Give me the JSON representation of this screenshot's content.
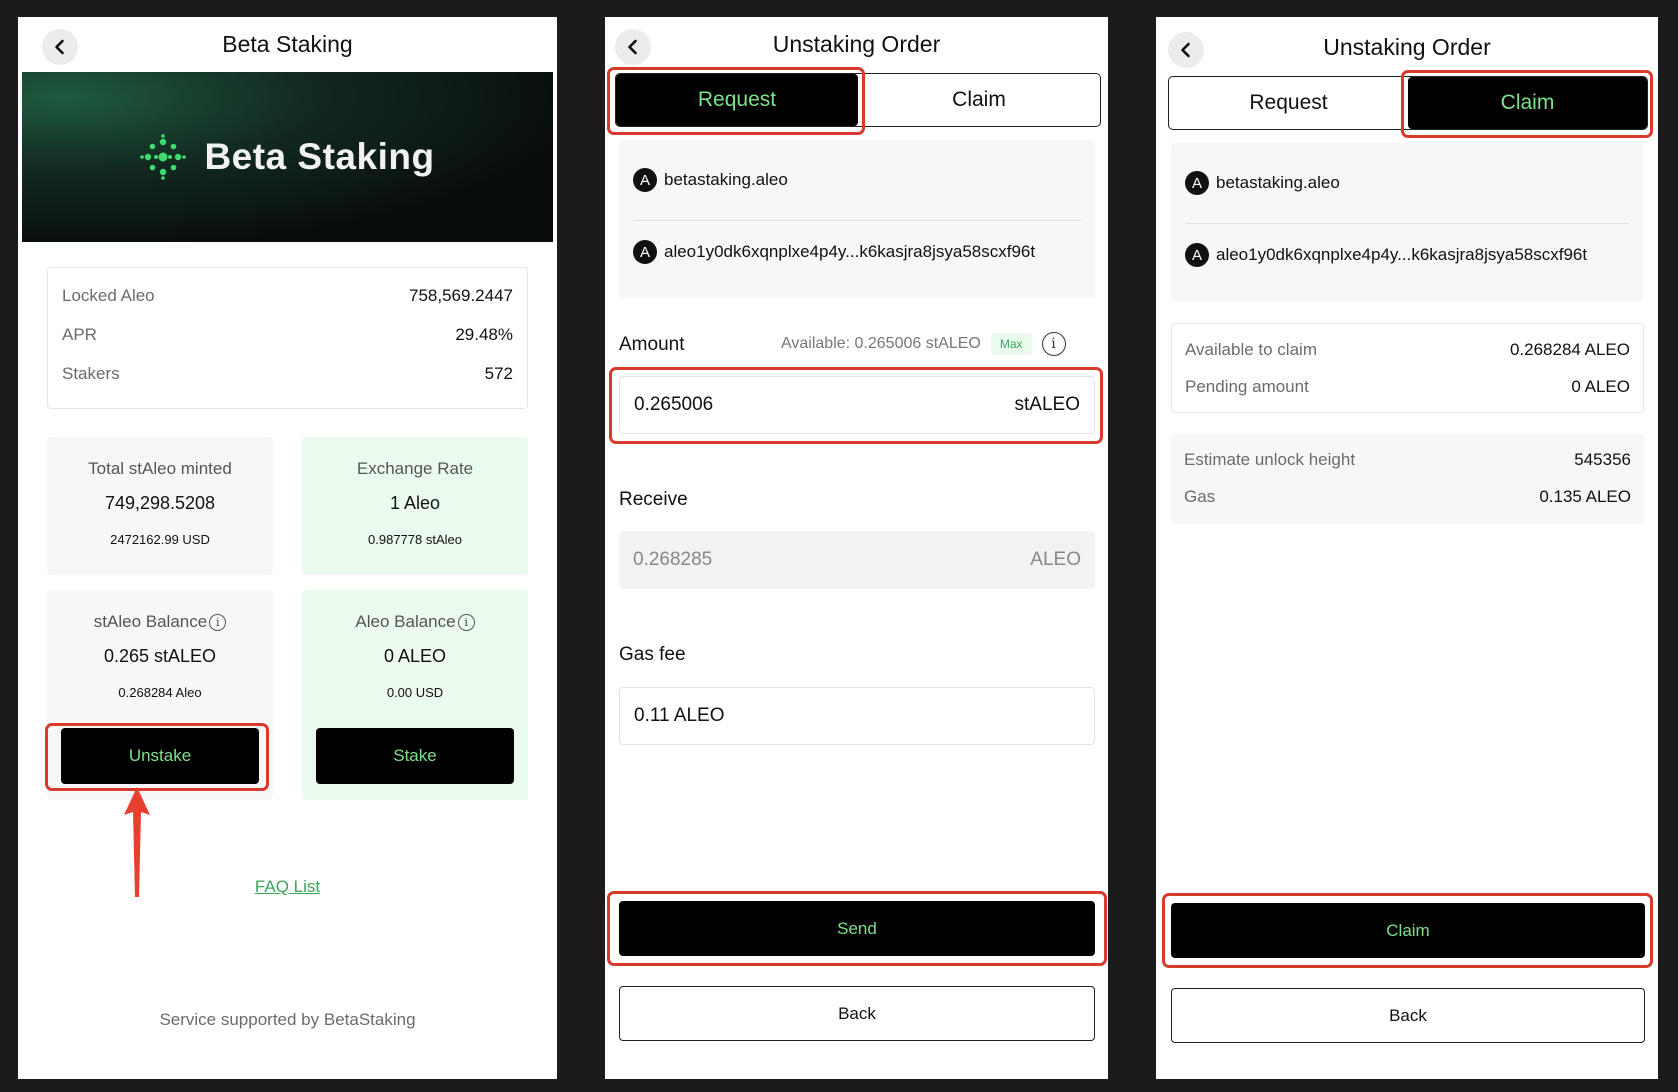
{
  "staking": {
    "title": "Beta Staking",
    "banner_text": "Beta Staking",
    "stats": [
      {
        "label": "Locked Aleo",
        "value": "758,569.2447"
      },
      {
        "label": "APR",
        "value": "29.48%"
      },
      {
        "label": "Stakers",
        "value": "572"
      }
    ],
    "cards": {
      "total_minted": {
        "title": "Total stAleo minted",
        "value": "749,298.5208",
        "sub": "2472162.99 USD"
      },
      "exchange_rate": {
        "title": "Exchange Rate",
        "value": "1 Aleo",
        "sub": "0.987778 stAleo"
      },
      "staleo_balance": {
        "title": "stAleo Balance",
        "value": "0.265 stALEO",
        "sub": "0.268284 Aleo",
        "button": "Unstake"
      },
      "aleo_balance": {
        "title": "Aleo Balance",
        "value": "0 ALEO",
        "sub": "0.00 USD",
        "button": "Stake"
      }
    },
    "faq": "FAQ List",
    "footer": "Service supported by BetaStaking"
  },
  "request_order": {
    "title": "Unstaking Order",
    "tabs": [
      "Request",
      "Claim"
    ],
    "account_name": "betastaking.aleo",
    "account_address": "aleo1y0dk6xqnplxe4p4y...k6kasjra8jsya58scxf96t",
    "amount_label": "Amount",
    "available_text": "Available: 0.265006 stALEO",
    "max_label": "Max",
    "amount_value": "0.265006",
    "amount_unit": "stALEO",
    "receive_label": "Receive",
    "receive_value": "0.268285",
    "receive_unit": "ALEO",
    "gas_label": "Gas fee",
    "gas_value": "0.11 ALEO",
    "send_label": "Send",
    "back_label": "Back"
  },
  "claim_order": {
    "title": "Unstaking Order",
    "tabs": [
      "Request",
      "Claim"
    ],
    "account_name": "betastaking.aleo",
    "account_address": "aleo1y0dk6xqnplxe4p4y...k6kasjra8jsya58scxf96t",
    "claim_info": [
      {
        "label": "Available to claim",
        "value": "0.268284 ALEO"
      },
      {
        "label": "Pending amount",
        "value": "0 ALEO"
      }
    ],
    "unlock_info": [
      {
        "label": "Estimate unlock height",
        "value": "545356"
      },
      {
        "label": "Gas",
        "value": "0.135 ALEO"
      }
    ],
    "claim_label": "Claim",
    "back_label": "Back"
  },
  "colors": {
    "accent_green": "#7ee08a",
    "highlight_red": "#d93a2b",
    "button_black": "#000000"
  },
  "icons": [
    "chevron-left-icon",
    "beta-staking-logo-icon",
    "info-icon",
    "aleo-avatar-icon",
    "red-arrow-up"
  ]
}
